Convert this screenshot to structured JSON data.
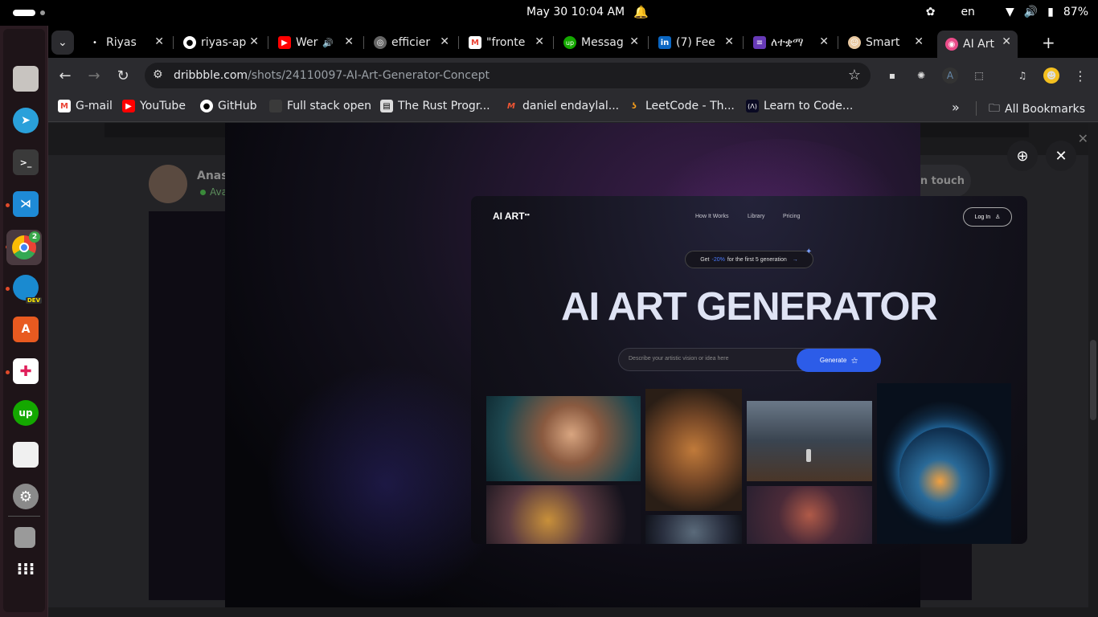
{
  "system": {
    "clock": "May 30  10:04 AM",
    "language": "en",
    "battery": "87%"
  },
  "dock": {
    "chrome_badge": "2",
    "edge_badge": "DEV"
  },
  "tabs": [
    {
      "title": "Riyas",
      "favicon": "github-dark-icon"
    },
    {
      "title": "riyas-ap",
      "favicon": "github-icon"
    },
    {
      "title": "Wer",
      "favicon": "youtube-icon"
    },
    {
      "title": "efficier",
      "favicon": "globe-icon"
    },
    {
      "title": "\"fronte",
      "favicon": "gmail-icon"
    },
    {
      "title": "Messag",
      "favicon": "upwork-icon"
    },
    {
      "title": "(7) Fee",
      "favicon": "linkedin-icon"
    },
    {
      "title": "ለተቋማ",
      "favicon": "forms-icon"
    },
    {
      "title": "Smart",
      "favicon": "avatar-icon"
    },
    {
      "title": "AI Art",
      "favicon": "dribbble-icon"
    }
  ],
  "omnibox": {
    "domain": "dribbble.com",
    "path": "/shots/24110097-AI-Art-Generator-Concept"
  },
  "bookmarks": [
    {
      "label": "G-mail",
      "icon": "gmail-icon"
    },
    {
      "label": "YouTube",
      "icon": "youtube-icon"
    },
    {
      "label": "GitHub",
      "icon": "github-icon"
    },
    {
      "label": "Full stack open",
      "icon": "blank-icon"
    },
    {
      "label": "The Rust Progr...",
      "icon": "book-icon"
    },
    {
      "label": "daniel endaylal...",
      "icon": "m-icon"
    },
    {
      "label": "LeetCode - Th...",
      "icon": "leetcode-icon"
    },
    {
      "label": "Learn to Code...",
      "icon": "freecodecamp-icon"
    }
  ],
  "bookmarks_folder": "All Bookmarks",
  "page": {
    "author_name": "Anast",
    "author_status": "Ava",
    "get_in_touch": "n touch"
  },
  "design": {
    "logo": "AI ART",
    "nav": [
      "How It Works",
      "Library",
      "Pricing"
    ],
    "login": "Log In",
    "promo_prefix": "Get",
    "promo_highlight": "-20%",
    "promo_suffix": "for the first 5 generation",
    "title": "AI ART GENERATOR",
    "search_placeholder": "Describe your artistic vision or idea here",
    "generate": "Generate"
  },
  "colors": {
    "accent_blue": "#2c5ce8",
    "tab_active": "#2b2b2f",
    "dock_bg": "#2a1b21"
  }
}
